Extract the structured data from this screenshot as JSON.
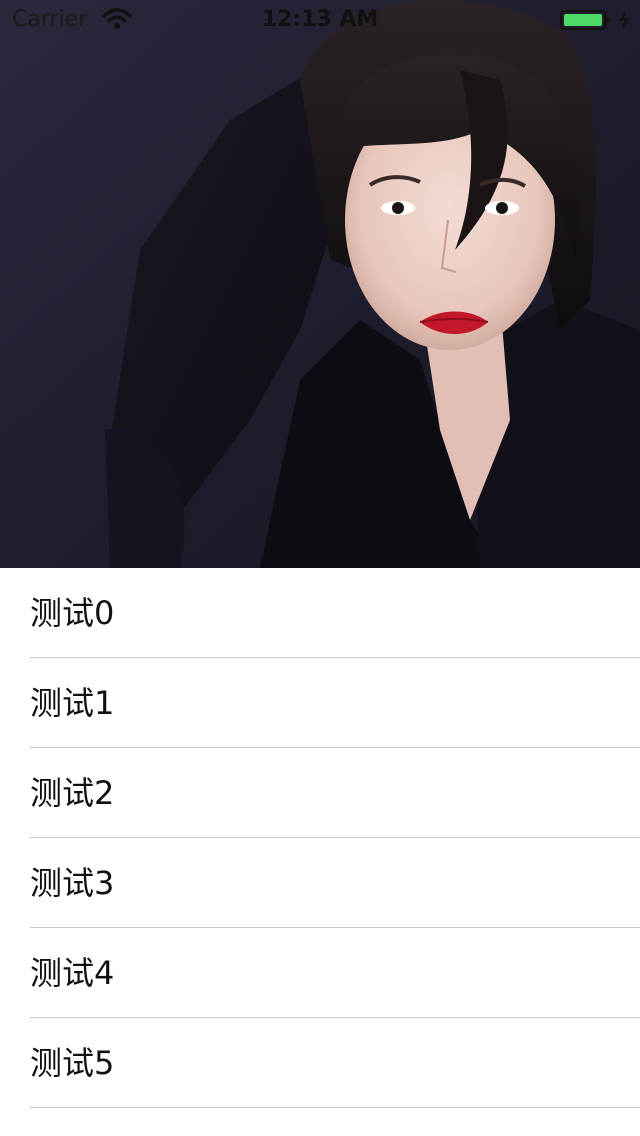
{
  "status_bar": {
    "carrier": "Carrier",
    "time": "12:13 AM",
    "wifi_icon": "wifi-icon",
    "battery_icon": "battery-icon",
    "charging_icon": "charging-bolt-icon",
    "battery_color": "#4cd964"
  },
  "header": {
    "image": "portrait-photo",
    "background_color": "#1e1d2c"
  },
  "list": {
    "items": [
      {
        "label": "测试0"
      },
      {
        "label": "测试1"
      },
      {
        "label": "测试2"
      },
      {
        "label": "测试3"
      },
      {
        "label": "测试4"
      },
      {
        "label": "测试5"
      }
    ],
    "separator_color": "#c8c7cc"
  }
}
